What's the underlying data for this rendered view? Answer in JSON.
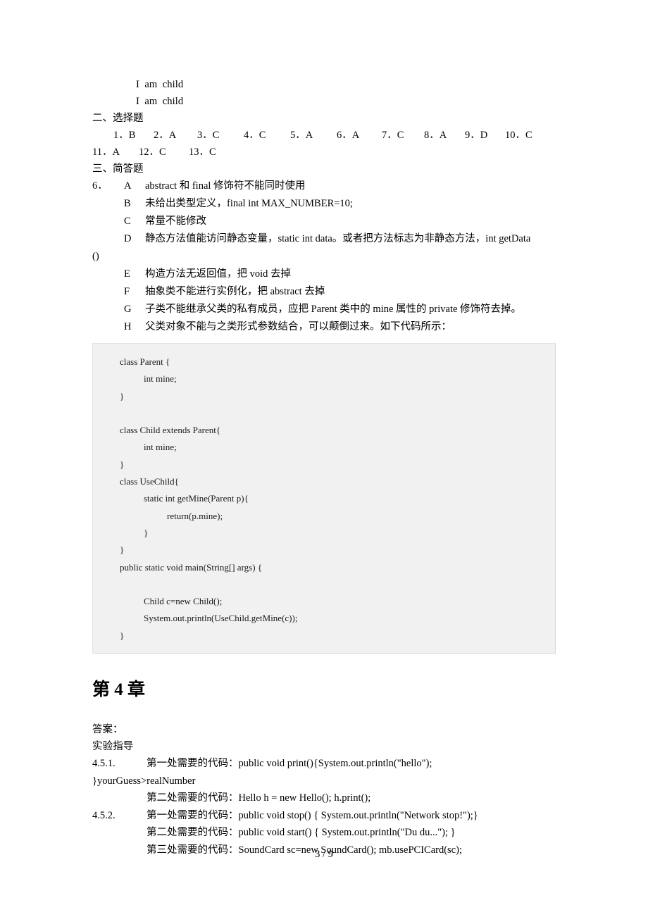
{
  "document": {
    "page_label": "3 / 9"
  },
  "output_lines": [
    "I  am  child",
    "I  am  child"
  ],
  "section_two": {
    "heading": "二、选择题",
    "answers_row1": [
      "1．B",
      "2．A",
      "3．C",
      "4．C",
      "5．A",
      "6．A",
      "7．C",
      "8．A",
      "9．D",
      "10．C"
    ],
    "answers_row2": [
      "11．A",
      "12．C",
      "13．C"
    ]
  },
  "section_three": {
    "heading": "三、简答题",
    "question_number": "6．",
    "items": [
      {
        "letter": "A",
        "text": "abstract 和 final 修饰符不能同时使用"
      },
      {
        "letter": "B",
        "text": "未给出类型定义，final  int  MAX_NUMBER=10;"
      },
      {
        "letter": "C",
        "text": "常量不能修改"
      },
      {
        "letter": "D",
        "text": "静态方法值能访问静态变量，static  int  data。或者把方法标志为非静态方法，int  getData"
      },
      {
        "letter": "E",
        "text": "构造方法无返回值，把 void 去掉"
      },
      {
        "letter": "F",
        "text": "抽象类不能进行实例化，把 abstract 去掉"
      },
      {
        "letter": "G",
        "text": "子类不能继承父类的私有成员，应把 Parent 类中的 mine 属性的 private 修饰符去掉。"
      },
      {
        "letter": "H",
        "text": "父类对象不能与之类形式参数结合，可以颠倒过来。如下代码所示："
      }
    ],
    "overflow_after_D": "()"
  },
  "code_block": [
    {
      "indent": 0,
      "text": "class Parent {"
    },
    {
      "indent": 1,
      "text": "int mine;"
    },
    {
      "indent": 0,
      "text": "}"
    },
    {
      "indent": 0,
      "text": ""
    },
    {
      "indent": 0,
      "text": "class Child extends Parent{"
    },
    {
      "indent": 1,
      "text": "int mine;"
    },
    {
      "indent": 0,
      "text": "}"
    },
    {
      "indent": 0,
      "text": "class UseChild{"
    },
    {
      "indent": 2,
      "text": "static int getMine(Parent p){"
    },
    {
      "indent": 3,
      "text": "return(p.mine);"
    },
    {
      "indent": 2,
      "text": "}"
    },
    {
      "indent": 0,
      "text": "}"
    },
    {
      "indent": 0,
      "text": "public static void main(String[] args) {"
    },
    {
      "indent": 0,
      "text": ""
    },
    {
      "indent": 2,
      "text": "Child c=new Child();"
    },
    {
      "indent": 2,
      "text": "System.out.println(UseChild.getMine(c));"
    },
    {
      "indent": 0,
      "text": "}"
    }
  ],
  "chapter": {
    "title": "第 4 章",
    "answer_label": "答案：",
    "guide_label": "实验指导"
  },
  "exercises": [
    {
      "number": "4.5.1.",
      "first": "第一处需要的代码：public void print(){System.out.println(\"hello\");",
      "overflow": "}yourGuess>realNumber",
      "rest": [
        "第二处需要的代码：Hello h = new Hello(); h.print();"
      ]
    },
    {
      "number": "4.5.2.",
      "first": "第一处需要的代码：public void stop() { System.out.println(\"Network stop!\");}",
      "overflow": "",
      "rest": [
        "第二处需要的代码：public void start()   { System.out.println(\"Du du...\"); }",
        "第三处需要的代码：SoundCard sc=new SoundCard();   mb.usePCICard(sc);"
      ]
    }
  ]
}
